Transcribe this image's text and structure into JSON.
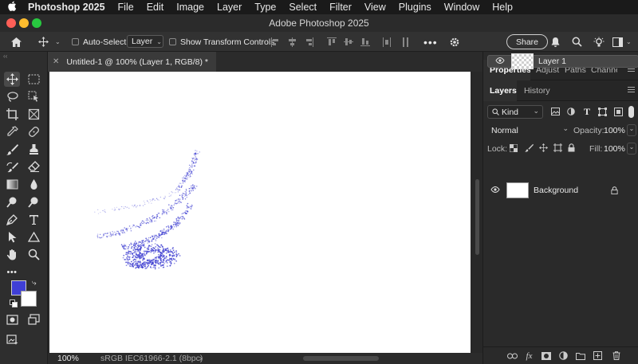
{
  "menubar": {
    "app": "Photoshop 2025",
    "items": [
      "File",
      "Edit",
      "Image",
      "Layer",
      "Type",
      "Select",
      "Filter",
      "View",
      "Plugins",
      "Window",
      "Help"
    ]
  },
  "window": {
    "title": "Adobe Photoshop 2025"
  },
  "options": {
    "auto_select_label": "Auto-Select:",
    "auto_select_value": "Layer",
    "auto_select_checked": false,
    "show_transform_label": "Show Transform Controls",
    "show_transform_checked": false,
    "share_label": "Share"
  },
  "document": {
    "tab_title": "Untitled-1 @ 100% (Layer 1, RGB/8) *",
    "zoom": "100%",
    "color_profile": "sRGB IEC61966-2.1 (8bpc)"
  },
  "colors": {
    "foreground": "#3f3fd6",
    "background": "#ffffff",
    "stroke": "#3a3ad0"
  },
  "panels": {
    "top_tabs": [
      "Properties",
      "Adjust",
      "Paths",
      "Channe"
    ],
    "layer_tabs": [
      "Layers",
      "History"
    ],
    "filter_kind": "Kind",
    "blend_mode": "Normal",
    "opacity_label": "Opacity:",
    "opacity_value": "100%",
    "lock_label": "Lock:",
    "fill_label": "Fill:",
    "fill_value": "100%"
  },
  "layers": [
    {
      "name": "Layer 1",
      "visible": true,
      "selected": true,
      "locked": false
    },
    {
      "name": "Background",
      "visible": true,
      "selected": false,
      "locked": true
    }
  ],
  "icons": {
    "toolbar": [
      "move-icon",
      "marquee-icon",
      "lasso-icon",
      "object-select-icon",
      "crop-icon",
      "frame-icon",
      "eyedropper-icon",
      "healing-brush-icon",
      "brush-icon",
      "clone-stamp-icon",
      "history-brush-icon",
      "eraser-icon",
      "gradient-icon",
      "blur-icon",
      "dodge-icon",
      "pen-icon",
      "type-icon",
      "path-select-icon",
      "shape-icon",
      "hand-icon",
      "zoom-icon",
      "more-tools-icon"
    ]
  }
}
